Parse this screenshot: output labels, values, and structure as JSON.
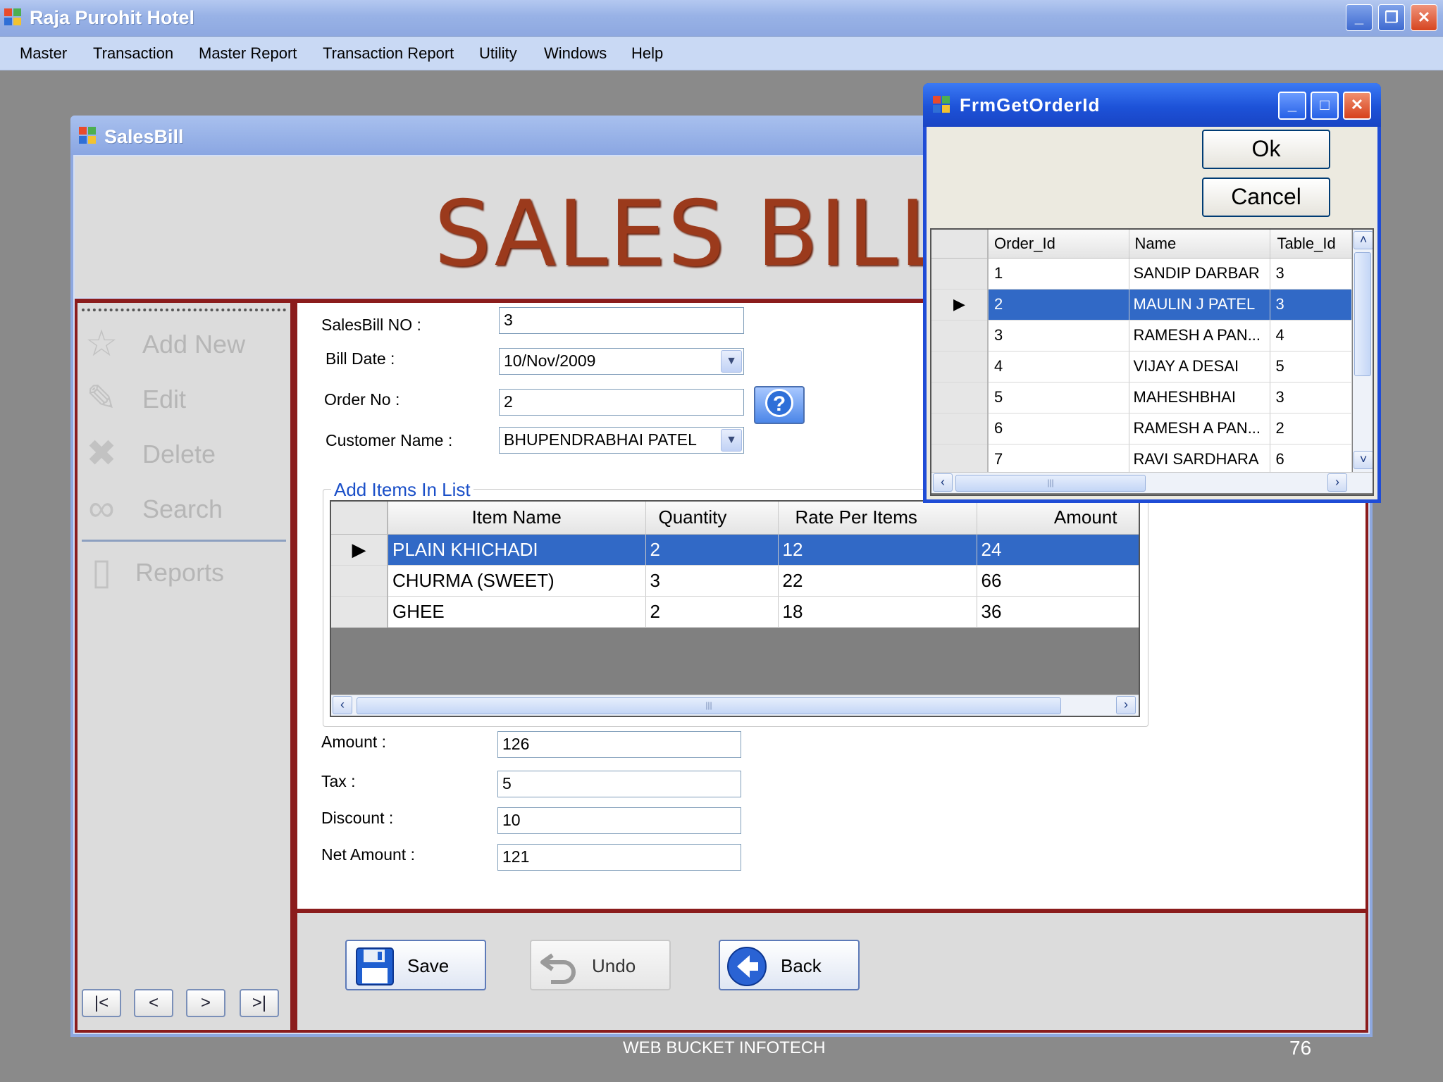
{
  "app": {
    "title": "Raja Purohit Hotel"
  },
  "menu": [
    "Master",
    "Transaction",
    "Master Report",
    "Transaction Report",
    "Utility",
    "Windows",
    "Help"
  ],
  "salesbill_window": {
    "title": "SalesBill",
    "heading": "SALES BILL",
    "sidebar": {
      "add_new": "Add New",
      "edit": "Edit",
      "delete": "Delete",
      "search": "Search",
      "reports": "Reports"
    },
    "nav": {
      "first": "|<",
      "prev": "<",
      "next": ">",
      "last": ">|"
    },
    "form": {
      "salesbill_no_label": "SalesBill NO :",
      "salesbill_no": "3",
      "bill_date_label": "Bill  Date :",
      "bill_date": "10/Nov/2009",
      "order_no_label": "Order No :",
      "order_no": "2",
      "customer_label": "Customer Name :",
      "customer": "BHUPENDRABHAI PATEL",
      "help_button": "?",
      "amount_label": "Amount :",
      "amount": "126",
      "tax_label": "Tax :",
      "tax": "5",
      "discount_label": "Discount :",
      "discount": "10",
      "net_amount_label": "Net Amount :",
      "net_amount": "121"
    },
    "items": {
      "legend": "Add Items In List",
      "columns": [
        "Item Name",
        "Quantity",
        "Rate Per Items",
        "Amount"
      ],
      "rows": [
        [
          "PLAIN KHICHADI",
          "2",
          "12",
          "24"
        ],
        [
          "CHURMA (SWEET)",
          "3",
          "22",
          "66"
        ],
        [
          "GHEE",
          "2",
          "18",
          "36"
        ]
      ],
      "selected_row": 0
    },
    "buttons": {
      "save": "Save",
      "undo": "Undo",
      "back": "Back"
    }
  },
  "dialog": {
    "title": "FrmGetOrderId",
    "ok": "Ok",
    "cancel": "Cancel",
    "columns": [
      "Order_Id",
      "Name",
      "Table_Id"
    ],
    "rows": [
      [
        "1",
        "SANDIP DARBAR",
        "3"
      ],
      [
        "2",
        "MAULIN J PATEL",
        "3"
      ],
      [
        "3",
        "RAMESH A PAN...",
        "4"
      ],
      [
        "4",
        "VIJAY A DESAI",
        "5"
      ],
      [
        "5",
        "MAHESHBHAI",
        "3"
      ],
      [
        "6",
        "RAMESH A PAN...",
        "2"
      ],
      [
        "7",
        "RAVI SARDHARA",
        "6"
      ]
    ],
    "selected_row": 1
  },
  "footer": {
    "company": "WEB BUCKET INFOTECH",
    "page": "76"
  },
  "colors": {
    "accent_red": "#8b1c1c",
    "selection_blue": "#3169c6",
    "title_blue": "#1f4cd6"
  }
}
